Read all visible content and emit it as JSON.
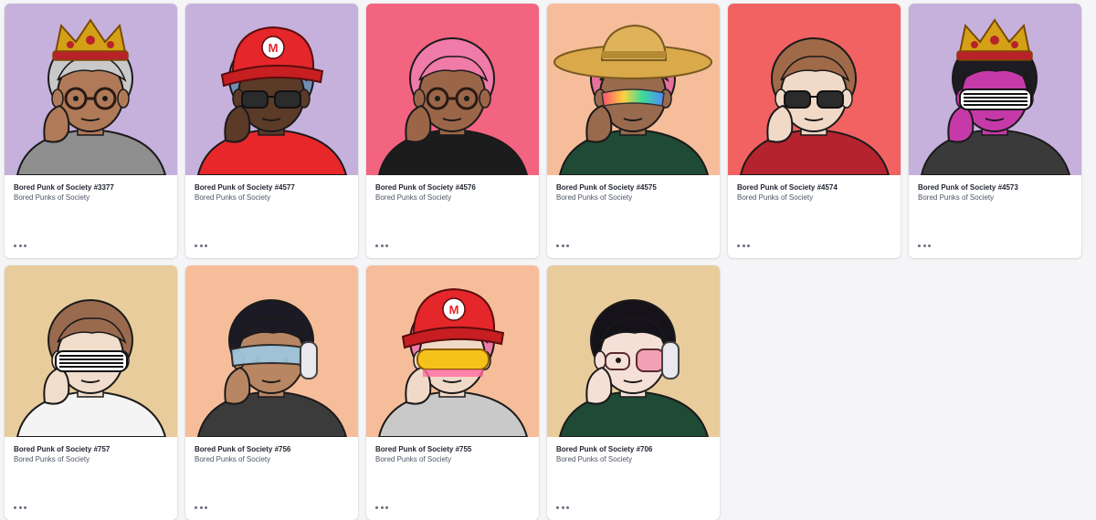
{
  "gallery": {
    "cards": [
      {
        "name": "Bored Punk of Society #3377",
        "collection": "Bored Punks of Society",
        "bg": "#c6b0dc",
        "skin": "#b07a58",
        "hair": "#c9c9c9",
        "shirt": "#8f8f8f",
        "headwear": "crown",
        "eyewear": "round-glasses"
      },
      {
        "name": "Bored Punk of Society #4577",
        "collection": "Bored Punks of Society",
        "bg": "#c6b0dc",
        "skin": "#5b3a28",
        "hair": "#6f8fb5",
        "shirt": "#e8272b",
        "headwear": "red-m-cap",
        "eyewear": "dark-glasses"
      },
      {
        "name": "Bored Punk of Society #4576",
        "collection": "Bored Punks of Society",
        "bg": "#f26480",
        "skin": "#9b6648",
        "hair": "#f07aa8",
        "shirt": "#1c1c1c",
        "headwear": "none",
        "eyewear": "round-glasses"
      },
      {
        "name": "Bored Punk of Society #4575",
        "collection": "Bored Punks of Society",
        "bg": "#f6bd9a",
        "skin": "#9a6a4e",
        "hair": "#e8709b",
        "shirt": "#1f4a35",
        "headwear": "straw-hat",
        "eyewear": "rainbow-shades"
      },
      {
        "name": "Bored Punk of Society #4574",
        "collection": "Bored Punks of Society",
        "bg": "#f26262",
        "skin": "#f1d9c8",
        "hair": "#a06a48",
        "shirt": "#b5232f",
        "headwear": "none",
        "eyewear": "dark-glasses"
      },
      {
        "name": "Bored Punk of Society #4573",
        "collection": "Bored Punks of Society",
        "bg": "#c6b0dc",
        "skin": "#c53aa8",
        "hair": "#1c1c22",
        "shirt": "#3a3a3a",
        "headwear": "crown",
        "eyewear": "shutter-shades"
      },
      {
        "name": "Bored Punk of Society #757",
        "collection": "Bored Punks of Society",
        "bg": "#e8cc9c",
        "skin": "#f1ddcc",
        "hair": "#9a6a4f",
        "shirt": "#f4f4f4",
        "headwear": "none",
        "eyewear": "shutter-shades"
      },
      {
        "name": "Bored Punk of Society #756",
        "collection": "Bored Punks of Society",
        "bg": "#f6bd9a",
        "skin": "#b98663",
        "hair": "#1c1a24",
        "shirt": "#3b3b3b",
        "headwear": "headphones",
        "eyewear": "visor"
      },
      {
        "name": "Bored Punk of Society #755",
        "collection": "Bored Punks of Society",
        "bg": "#f6bd9a",
        "skin": "#f1d9c8",
        "hair": "#f07aa8",
        "shirt": "#c9c9c9",
        "headwear": "red-m-cap",
        "eyewear": "yellow-visor"
      },
      {
        "name": "Bored Punk of Society #706",
        "collection": "Bored Punks of Society",
        "bg": "#e8cc9c",
        "skin": "#f4e0d6",
        "hair": "#15121a",
        "shirt": "#1f4a35",
        "headwear": "headphones",
        "eyewear": "pink-glasses"
      }
    ]
  }
}
